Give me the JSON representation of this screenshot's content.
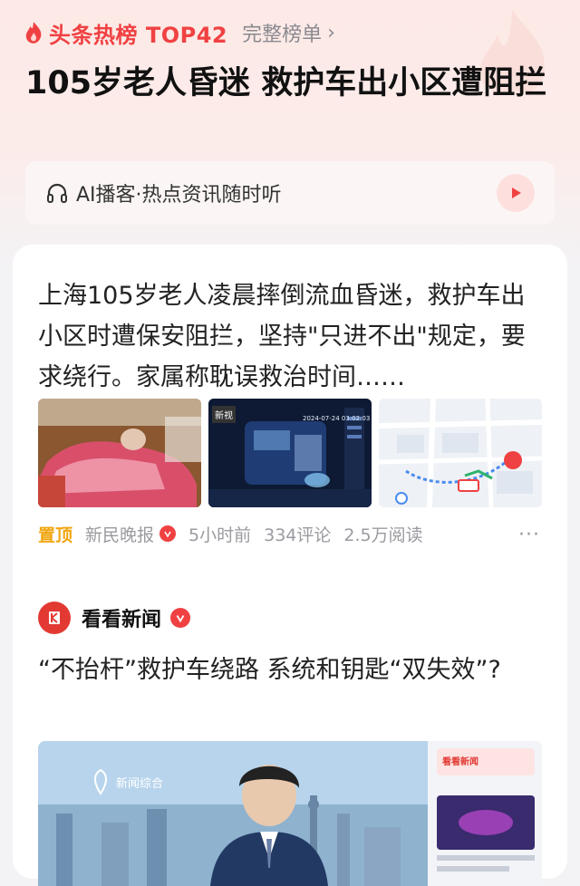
{
  "hot_list": {
    "title": "头条热榜 TOP42",
    "full_list_link": "完整榜单",
    "chevron": "›"
  },
  "headline": "105岁老人昏迷 救护车出小区遭阻拦",
  "podcast": {
    "label": "AI播客·热点资讯随时听"
  },
  "article": {
    "summary": "上海105岁老人凌晨摔倒流血昏迷，救护车出小区时遭保安阻拦，坚持\"只进不出\"规定，要求绕行。家属称耽误救治时间……",
    "thumb2_overlay": "新视",
    "thumb2_timestamp": "2024-07-24 03:02:03",
    "meta": {
      "pin": "置顶",
      "source": "新民晚报",
      "time": "5小时前",
      "comments": "334评论",
      "reads": "2.5万阅读"
    }
  },
  "post": {
    "author": "看看新闻",
    "title": "“不抬杆”救护车绕路 系统和钥匙“双失效”?",
    "video_channel": "新闻综合",
    "video_inset_brand": "看看新闻"
  },
  "colors": {
    "accent": "#f04142",
    "pin": "#f0a50f",
    "meta": "#9a9aa0"
  },
  "icons": [
    "flame-icon",
    "headphone-icon",
    "play-icon",
    "verified-icon",
    "more-icon",
    "kankan-logo-icon"
  ]
}
